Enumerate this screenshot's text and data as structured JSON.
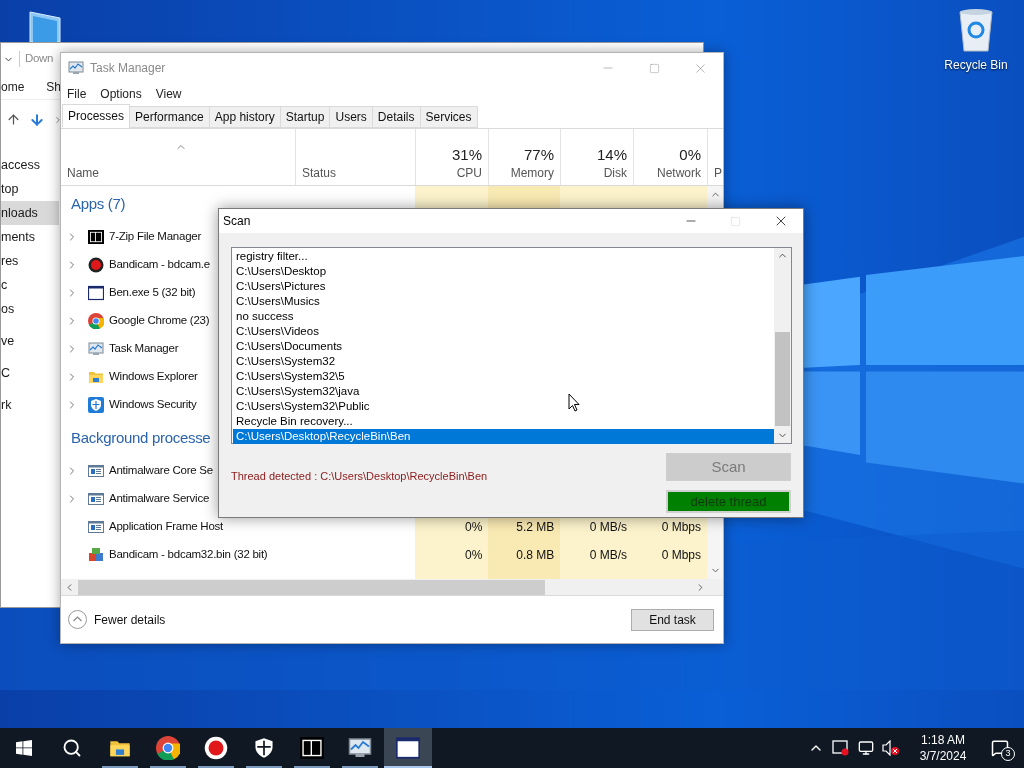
{
  "desktop_icons": [
    {
      "kind": "computer"
    },
    {
      "kind": "recycle-bin",
      "label": "Recycle Bin"
    }
  ],
  "explorer": {
    "address": "Down",
    "ribbon_tabs": [
      "ome",
      "Sh"
    ],
    "nav_pane": [
      {
        "label": "access",
        "selected": false,
        "children": [
          {
            "label": "top",
            "selected": false
          },
          {
            "label": "nloads",
            "selected": true
          },
          {
            "label": "ments",
            "selected": false
          },
          {
            "label": "res",
            "selected": false
          },
          {
            "label": "c",
            "selected": false
          },
          {
            "label": "os",
            "selected": false
          }
        ]
      },
      {
        "label": "ve",
        "selected": false
      },
      {
        "label": "C",
        "selected": false
      },
      {
        "label": "rk",
        "selected": false
      }
    ]
  },
  "task_manager": {
    "title": "Task Manager",
    "active": false,
    "menu": [
      "File",
      "Options",
      "View"
    ],
    "tabs": [
      {
        "label": "Processes",
        "selected": true
      },
      {
        "label": "Performance",
        "selected": false
      },
      {
        "label": "App history",
        "selected": false
      },
      {
        "label": "Startup",
        "selected": false
      },
      {
        "label": "Users",
        "selected": false
      },
      {
        "label": "Details",
        "selected": false
      },
      {
        "label": "Services",
        "selected": false
      }
    ],
    "columns": [
      {
        "label": "Name"
      },
      {
        "label": "Status"
      },
      {
        "usage": "31%",
        "label": "CPU"
      },
      {
        "usage": "77%",
        "label": "Memory"
      },
      {
        "usage": "14%",
        "label": "Disk"
      },
      {
        "usage": "0%",
        "label": "Network"
      },
      {
        "label": "P"
      }
    ],
    "groups": [
      {
        "title": "Apps (7)",
        "rows": [
          {
            "name": "7-Zip File Manager",
            "kind": "archive",
            "expandable": true
          },
          {
            "name": "Bandicam - bdcam.e",
            "kind": "record",
            "expandable": true
          },
          {
            "name": "Ben.exe 5 (32 bit)",
            "kind": "window",
            "expandable": true
          },
          {
            "name": "Google Chrome (23)",
            "kind": "chrome",
            "expandable": true
          },
          {
            "name": "Task Manager",
            "kind": "taskmgr",
            "expandable": true
          },
          {
            "name": "Windows Explorer",
            "kind": "folder",
            "expandable": true
          },
          {
            "name": "Windows Security",
            "kind": "shield",
            "expandable": true
          }
        ]
      },
      {
        "title": "Background processe",
        "rows": [
          {
            "name": "Antimalware Core Se",
            "kind": "service",
            "expandable": true
          },
          {
            "name": "Antimalware Service",
            "kind": "service",
            "expandable": true
          },
          {
            "name": "Application Frame Host",
            "kind": "service",
            "expandable": false,
            "cpu": "0%",
            "memory": "5.2 MB",
            "disk": "0 MB/s",
            "network": "0 Mbps"
          },
          {
            "name": "Bandicam - bdcam32.bin (32 bit)",
            "kind": "blocks",
            "expandable": false,
            "cpu": "0%",
            "memory": "0.8 MB",
            "disk": "0 MB/s",
            "network": "0 Mbps"
          }
        ]
      }
    ],
    "fewer_details": "Fewer details",
    "end_task": "End task"
  },
  "scan": {
    "title": "Scan",
    "active": true,
    "maximize_disabled": true,
    "log": [
      {
        "text": "registry filter...",
        "selected": false
      },
      {
        "text": "C:\\Users\\Desktop",
        "selected": false
      },
      {
        "text": "C:\\Users\\Pictures",
        "selected": false
      },
      {
        "text": "C:\\Users\\Musics",
        "selected": false
      },
      {
        "text": "no success",
        "selected": false
      },
      {
        "text": "C:\\Users\\Videos",
        "selected": false
      },
      {
        "text": "C:\\Users\\Documents",
        "selected": false
      },
      {
        "text": "C:\\Users\\System32",
        "selected": false
      },
      {
        "text": "C:\\Users\\System32\\5",
        "selected": false
      },
      {
        "text": "C:\\Users\\System32\\java",
        "selected": false
      },
      {
        "text": "C:\\Users\\System32\\Public",
        "selected": false
      },
      {
        "text": "Recycle Bin recovery...",
        "selected": false
      },
      {
        "text": "C:\\Users\\Desktop\\RecycleBin\\Ben",
        "selected": true
      }
    ],
    "message": "Thread detected : C:\\Users\\Desktop\\RecycleBin\\Ben",
    "buttons": [
      {
        "label": "Scan",
        "kind": "scan",
        "disabled": true
      },
      {
        "label": "delete thread",
        "kind": "delete",
        "disabled": false
      }
    ]
  },
  "taskbar": {
    "items": [
      {
        "kind": "start",
        "running": false,
        "selected": false
      },
      {
        "kind": "search",
        "running": false,
        "selected": false
      },
      {
        "kind": "folder",
        "running": true,
        "selected": false
      },
      {
        "kind": "chrome",
        "running": true,
        "selected": false
      },
      {
        "kind": "record",
        "running": true,
        "selected": false
      },
      {
        "kind": "shield",
        "running": true,
        "selected": false
      },
      {
        "kind": "archive",
        "running": true,
        "selected": false
      },
      {
        "kind": "taskmgr",
        "running": true,
        "selected": false
      },
      {
        "kind": "window",
        "running": true,
        "selected": true
      }
    ],
    "time": "1:18 AM",
    "date": "3/7/2024",
    "notifications": "3"
  }
}
